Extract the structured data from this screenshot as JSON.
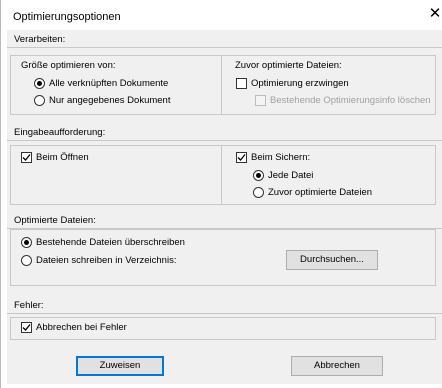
{
  "window": {
    "title": "Optimierungsoptionen",
    "close_glyph": "✕"
  },
  "verarbeiten": {
    "label": "Verarbeiten:",
    "size_group": {
      "label": "Größe optimieren von:",
      "options": [
        "Alle verknüpften Dokumente",
        "Nur angegebenes Dokument"
      ],
      "selected": 0
    },
    "prev_group": {
      "label": "Zuvor optimierte Dateien:",
      "force_label": "Optimierung erzwingen",
      "force_checked": false,
      "delete_label": "Bestehende Optimierungsinfo löschen",
      "delete_checked": false,
      "delete_enabled": false
    }
  },
  "eingabe": {
    "label": "Eingabeaufforderung:",
    "on_open_label": "Beim Öffnen",
    "on_open_checked": true,
    "on_save_label": "Beim Sichern:",
    "on_save_checked": true,
    "save_options": [
      "Jede Datei",
      "Zuvor optimierte Dateien"
    ],
    "save_selected": 0
  },
  "dateien": {
    "label": "Optimierte Dateien:",
    "options": [
      "Bestehende Dateien überschreiben",
      "Dateien schreiben in Verzeichnis:"
    ],
    "selected": 0,
    "browse_label": "Durchsuchen..."
  },
  "fehler": {
    "label": "Fehler:",
    "abort_label": "Abbrechen bei Fehler",
    "abort_checked": true
  },
  "buttons": {
    "apply": "Zuweisen",
    "cancel": "Abbrechen"
  }
}
